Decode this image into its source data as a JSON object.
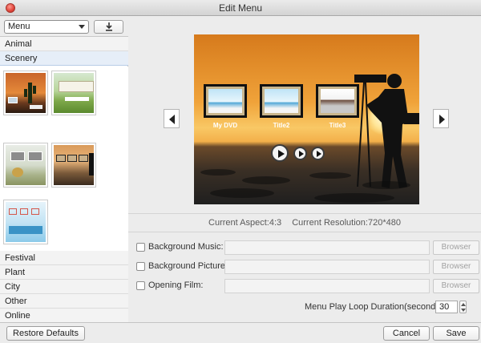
{
  "window": {
    "title": "Edit Menu"
  },
  "left": {
    "menu_select": {
      "value": "Menu"
    },
    "download_icon": "download-icon",
    "categories_top": [
      {
        "label": "Animal"
      },
      {
        "label": "Scenery"
      }
    ],
    "categories_bottom": [
      {
        "label": "Festival"
      },
      {
        "label": "Plant"
      },
      {
        "label": "City"
      },
      {
        "label": "Other"
      },
      {
        "label": "Online"
      }
    ]
  },
  "preview": {
    "titles": [
      "My DVD",
      "Title2",
      "Title3"
    ]
  },
  "info": {
    "aspect": "Current Aspect:4:3",
    "resolution": "Current Resolution:720*480"
  },
  "options": [
    {
      "label": "Background Music:",
      "browse": "Browser"
    },
    {
      "label": "Background Picture:",
      "browse": "Browser"
    },
    {
      "label": "Opening Film:",
      "browse": "Browser"
    }
  ],
  "loop": {
    "label": "Menu Play Loop Duration(seconds):",
    "value": "30"
  },
  "buttons": {
    "restore": "Restore Defaults",
    "cancel": "Cancel",
    "save": "Save"
  },
  "colors": {
    "selected_category": "#e6eef8",
    "sunset": "#f0a33a"
  }
}
